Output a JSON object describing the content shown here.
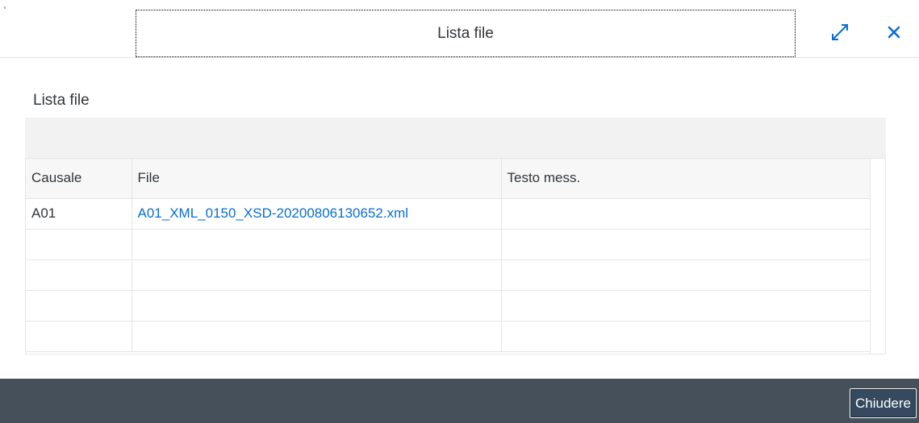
{
  "header": {
    "title": "Lista file",
    "resize_icon": "resize-icon",
    "close_icon": "close-icon"
  },
  "section": {
    "title": "Lista file"
  },
  "table": {
    "columns": [
      "Causale",
      "File",
      "Testo mess."
    ],
    "rows": [
      [
        "A01",
        "A01_XML_0150_XSD-20200806130652.xml",
        ""
      ],
      [
        "",
        "",
        ""
      ],
      [
        "",
        "",
        ""
      ],
      [
        "",
        "",
        ""
      ],
      [
        "",
        "",
        ""
      ]
    ]
  },
  "footer": {
    "close_label": "Chiudere"
  },
  "colors": {
    "link": "#0a6ed1",
    "footer_bg": "#45505a",
    "button_bg": "#354a5f"
  }
}
